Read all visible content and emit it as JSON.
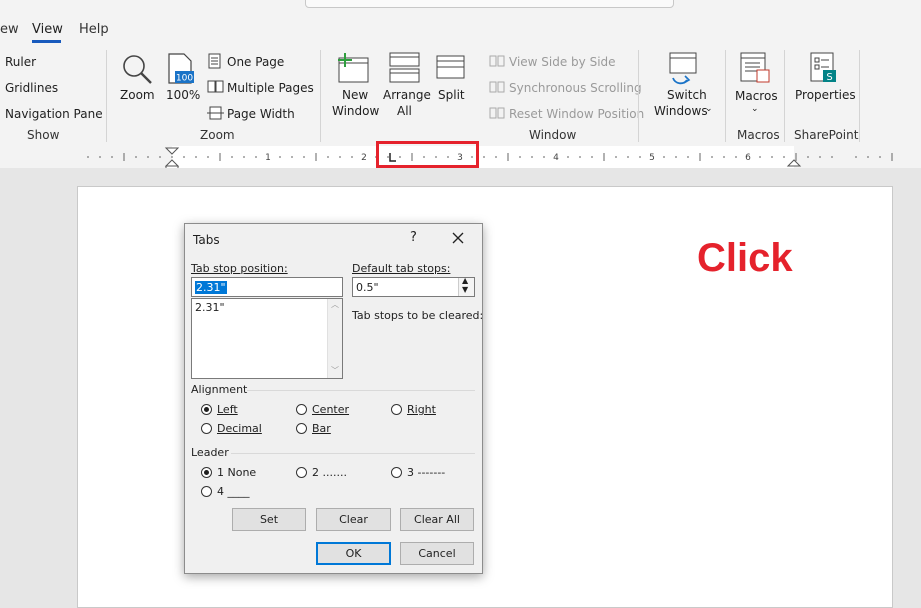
{
  "tabs": {
    "partial": "ew",
    "view": "View",
    "help": "Help"
  },
  "show_group": {
    "ruler": "Ruler",
    "gridlines": "Gridlines",
    "navigation_pane": "Navigation Pane",
    "label": "Show"
  },
  "zoom_group": {
    "zoom": "Zoom",
    "hundred": "100%",
    "hundred_icon": "100",
    "one_page": "One Page",
    "multiple_pages": "Multiple Pages",
    "page_width": "Page Width",
    "label": "Zoom"
  },
  "window_group": {
    "new_window_1": "New",
    "new_window_2": "Window",
    "arrange_all_1": "Arrange",
    "arrange_all_2": "All",
    "split": "Split",
    "view_side_by_side": "View Side by Side",
    "synchronous_scrolling": "Synchronous Scrolling",
    "reset_window_position": "Reset Window Position",
    "switch_windows_1": "Switch",
    "switch_windows_2": "Windows",
    "label": "Window"
  },
  "macros_group": {
    "macros": "Macros",
    "label": "Macros"
  },
  "sharepoint_group": {
    "properties": "Properties",
    "label": "SharePoint"
  },
  "ruler": {
    "numbers": [
      "1",
      "2",
      "3",
      "4",
      "5",
      "6"
    ]
  },
  "annotation": {
    "click": "Click"
  },
  "dialog": {
    "title": "Tabs",
    "help": "?",
    "tab_stop_label": "Tab stop position:",
    "tab_stop_value": "2.31\"",
    "tab_stop_list": [
      "2.31\""
    ],
    "default_tab_label": "Default tab stops:",
    "default_tab_value": "0.5\"",
    "cleared_label": "Tab stops to be cleared:",
    "alignment_label": "Alignment",
    "alignment": {
      "left": "Left",
      "center": "Center",
      "right": "Right",
      "decimal": "Decimal",
      "bar": "Bar"
    },
    "leader_label": "Leader",
    "leader": {
      "one": "1 None",
      "two": "2 .......",
      "three": "3 -------",
      "four": "4 ____"
    },
    "buttons": {
      "set": "Set",
      "clear": "Clear",
      "clear_all": "Clear All",
      "ok": "OK",
      "cancel": "Cancel"
    }
  }
}
